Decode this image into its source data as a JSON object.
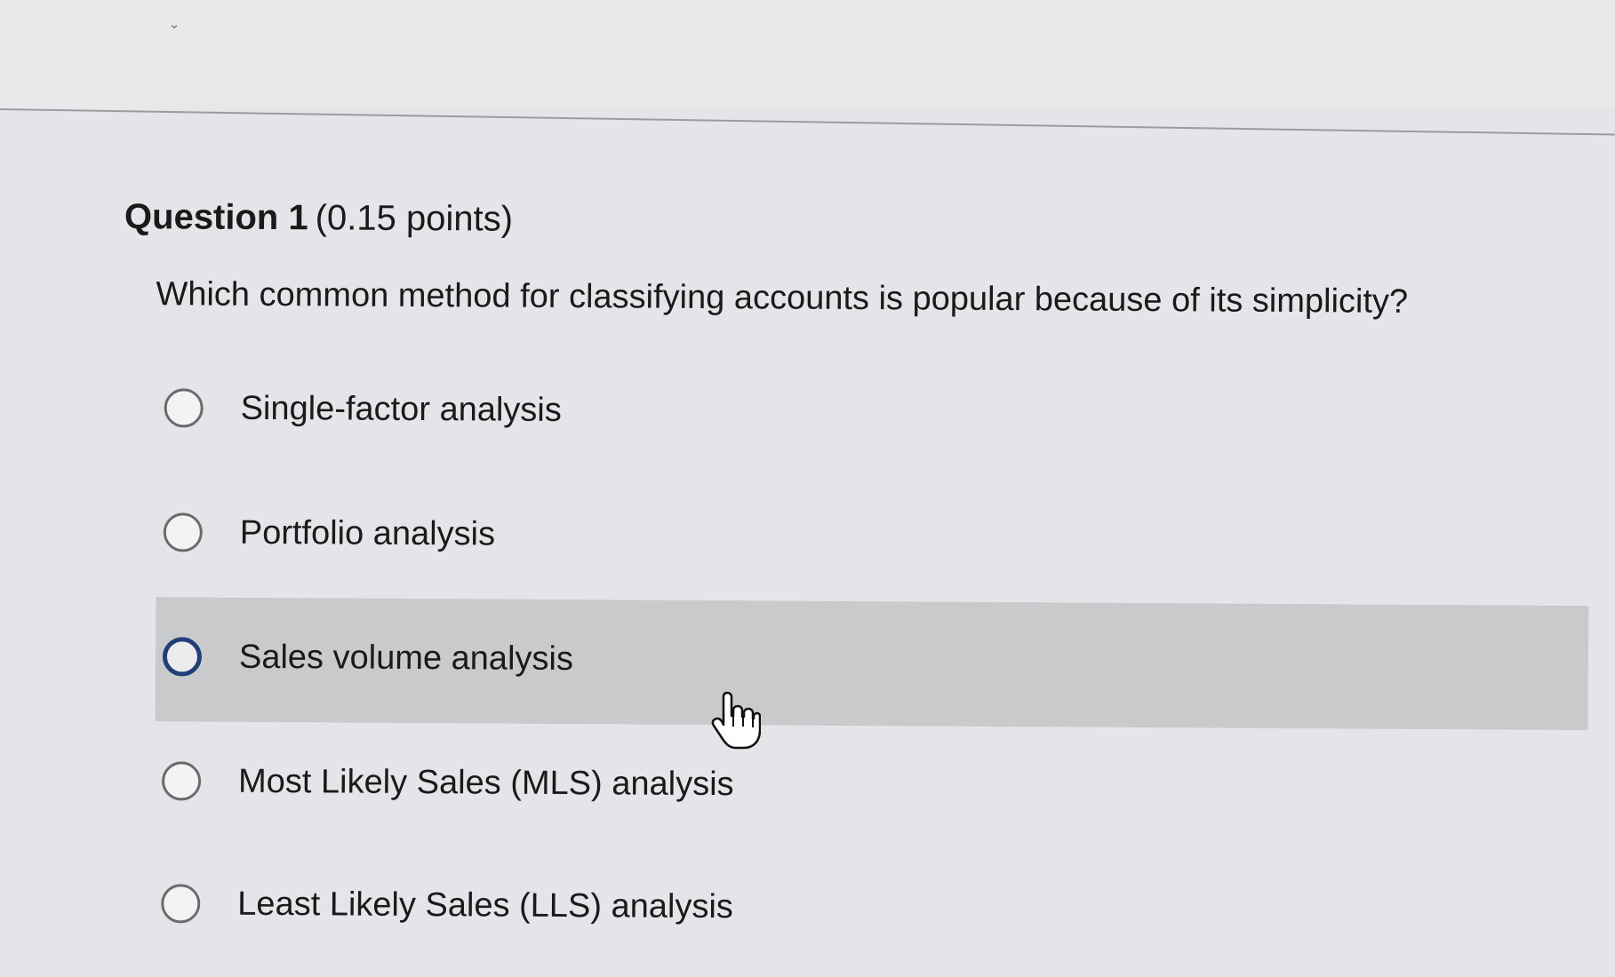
{
  "question": {
    "title": "Question 1",
    "points": "(0.15 points)",
    "prompt": "Which common method for classifying accounts is popular because of its simplicity?"
  },
  "options": [
    {
      "label": "Single-factor analysis",
      "selected": false
    },
    {
      "label": "Portfolio analysis",
      "selected": false
    },
    {
      "label": "Sales volume analysis",
      "selected": false,
      "hovered": true
    },
    {
      "label": "Most Likely Sales (MLS) analysis",
      "selected": false
    },
    {
      "label": "Least Likely Sales (LLS) analysis",
      "selected": false
    }
  ],
  "icons": {
    "collapse": "chevron-down-icon",
    "cursor": "hand-pointer-icon"
  },
  "colors": {
    "background": "#e4e5e8",
    "hover_row": "#c9cacc",
    "radio_focus": "#1f3f7a"
  }
}
